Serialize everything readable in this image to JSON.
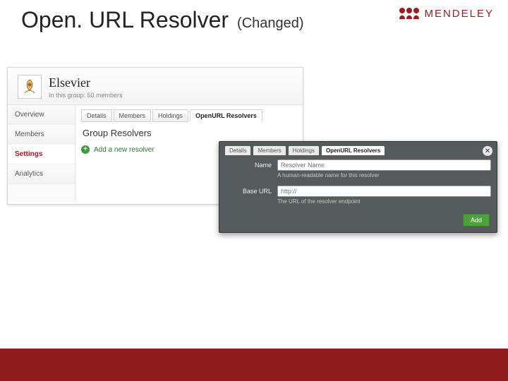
{
  "title": {
    "main": "Open. URL Resolver",
    "sub": "(Changed)"
  },
  "brand": {
    "name": "MENDELEY",
    "color": "#9b1b1f"
  },
  "panel_a": {
    "header": {
      "brand": "Elsevier",
      "subtitle": "In this group: 50 members"
    },
    "sidebar": [
      {
        "label": "Overview",
        "active": false
      },
      {
        "label": "Members",
        "active": false
      },
      {
        "label": "Settings",
        "active": true
      },
      {
        "label": "Analytics",
        "active": false
      }
    ],
    "tabs": [
      {
        "label": "Details",
        "active": false
      },
      {
        "label": "Members",
        "active": false
      },
      {
        "label": "Holdings",
        "active": false
      },
      {
        "label": "OpenURL Resolvers",
        "active": true
      }
    ],
    "section_title": "Group Resolvers",
    "add_link": "Add a new resolver"
  },
  "panel_b": {
    "tabs": [
      {
        "label": "Details",
        "active": false
      },
      {
        "label": "Members",
        "active": false
      },
      {
        "label": "Holdings",
        "active": false
      },
      {
        "label": "OpenURL Resolvers",
        "active": true
      }
    ],
    "fields": {
      "name": {
        "label": "Name",
        "placeholder": "Resolver Name",
        "hint": "A human-readable name for this resolver"
      },
      "base_url": {
        "label": "Base URL",
        "placeholder": "http://",
        "hint": "The URL of the resolver endpoint"
      }
    },
    "add_button": "Add"
  }
}
